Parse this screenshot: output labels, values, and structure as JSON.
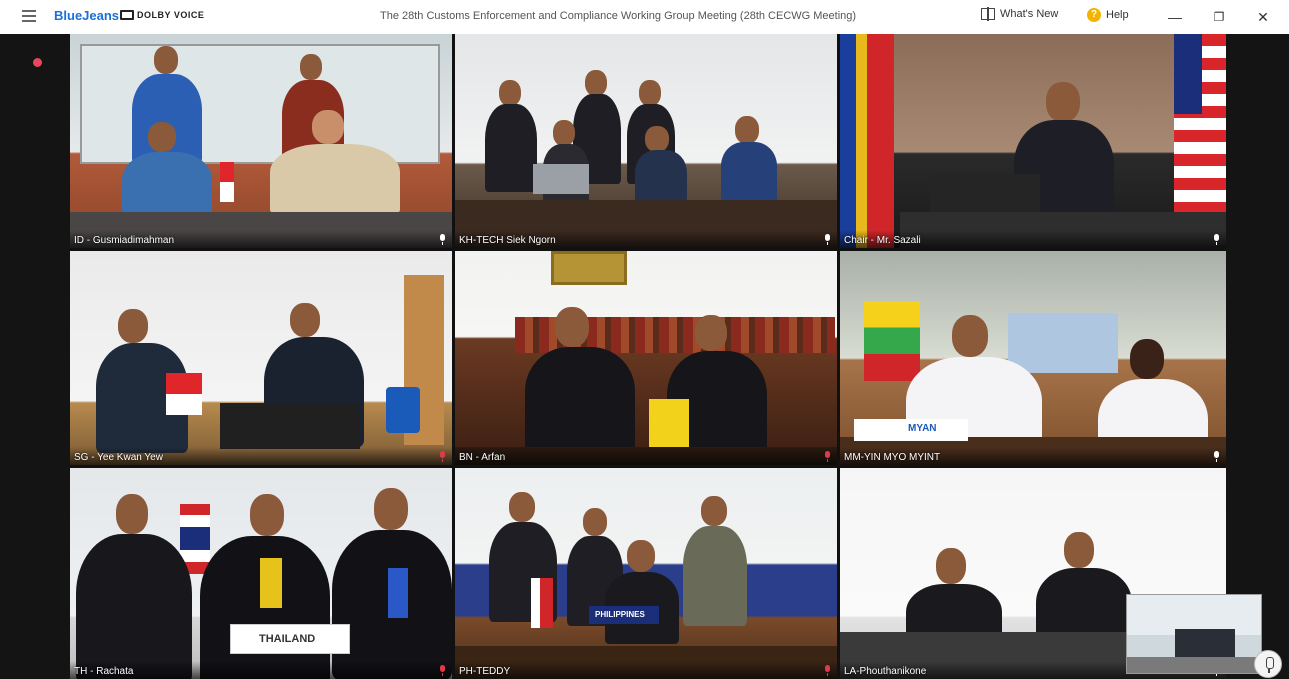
{
  "app": {
    "brand": "BlueJeans",
    "dolby_label": "DOLBY VOICE",
    "meeting_title": "The 28th Customs Enforcement and Compliance Working Group Meeting (28th CECWG Meeting)"
  },
  "toolbar": {
    "whats_new": "What's New",
    "help": "Help",
    "minimize": "—",
    "maximize": "❐",
    "close": "✕"
  },
  "participants": [
    {
      "name": "ID - Gusmiadimahman",
      "mic": "on"
    },
    {
      "name": "KH-TECH Siek Ngorn",
      "mic": "on"
    },
    {
      "name": "Chair - Mr. Sazali",
      "mic": "on"
    },
    {
      "name": "SG - Yee Kwan Yew",
      "mic": "muted"
    },
    {
      "name": "BN - Arfan",
      "mic": "muted"
    },
    {
      "name": "MM-YIN MYO MYINT",
      "mic": "on"
    },
    {
      "name": "TH - Rachata",
      "mic": "muted"
    },
    {
      "name": "PH-TEDDY",
      "mic": "muted"
    },
    {
      "name": "LA-Phouthanikone",
      "mic": "on"
    }
  ],
  "signs": {
    "thailand": "THAILAND",
    "philippines": "PHILIPPINES",
    "myanmar": "MYAN"
  },
  "colors": {
    "accent": "#1a6fd9",
    "record": "#e8465f",
    "muted": "#e0394f"
  }
}
